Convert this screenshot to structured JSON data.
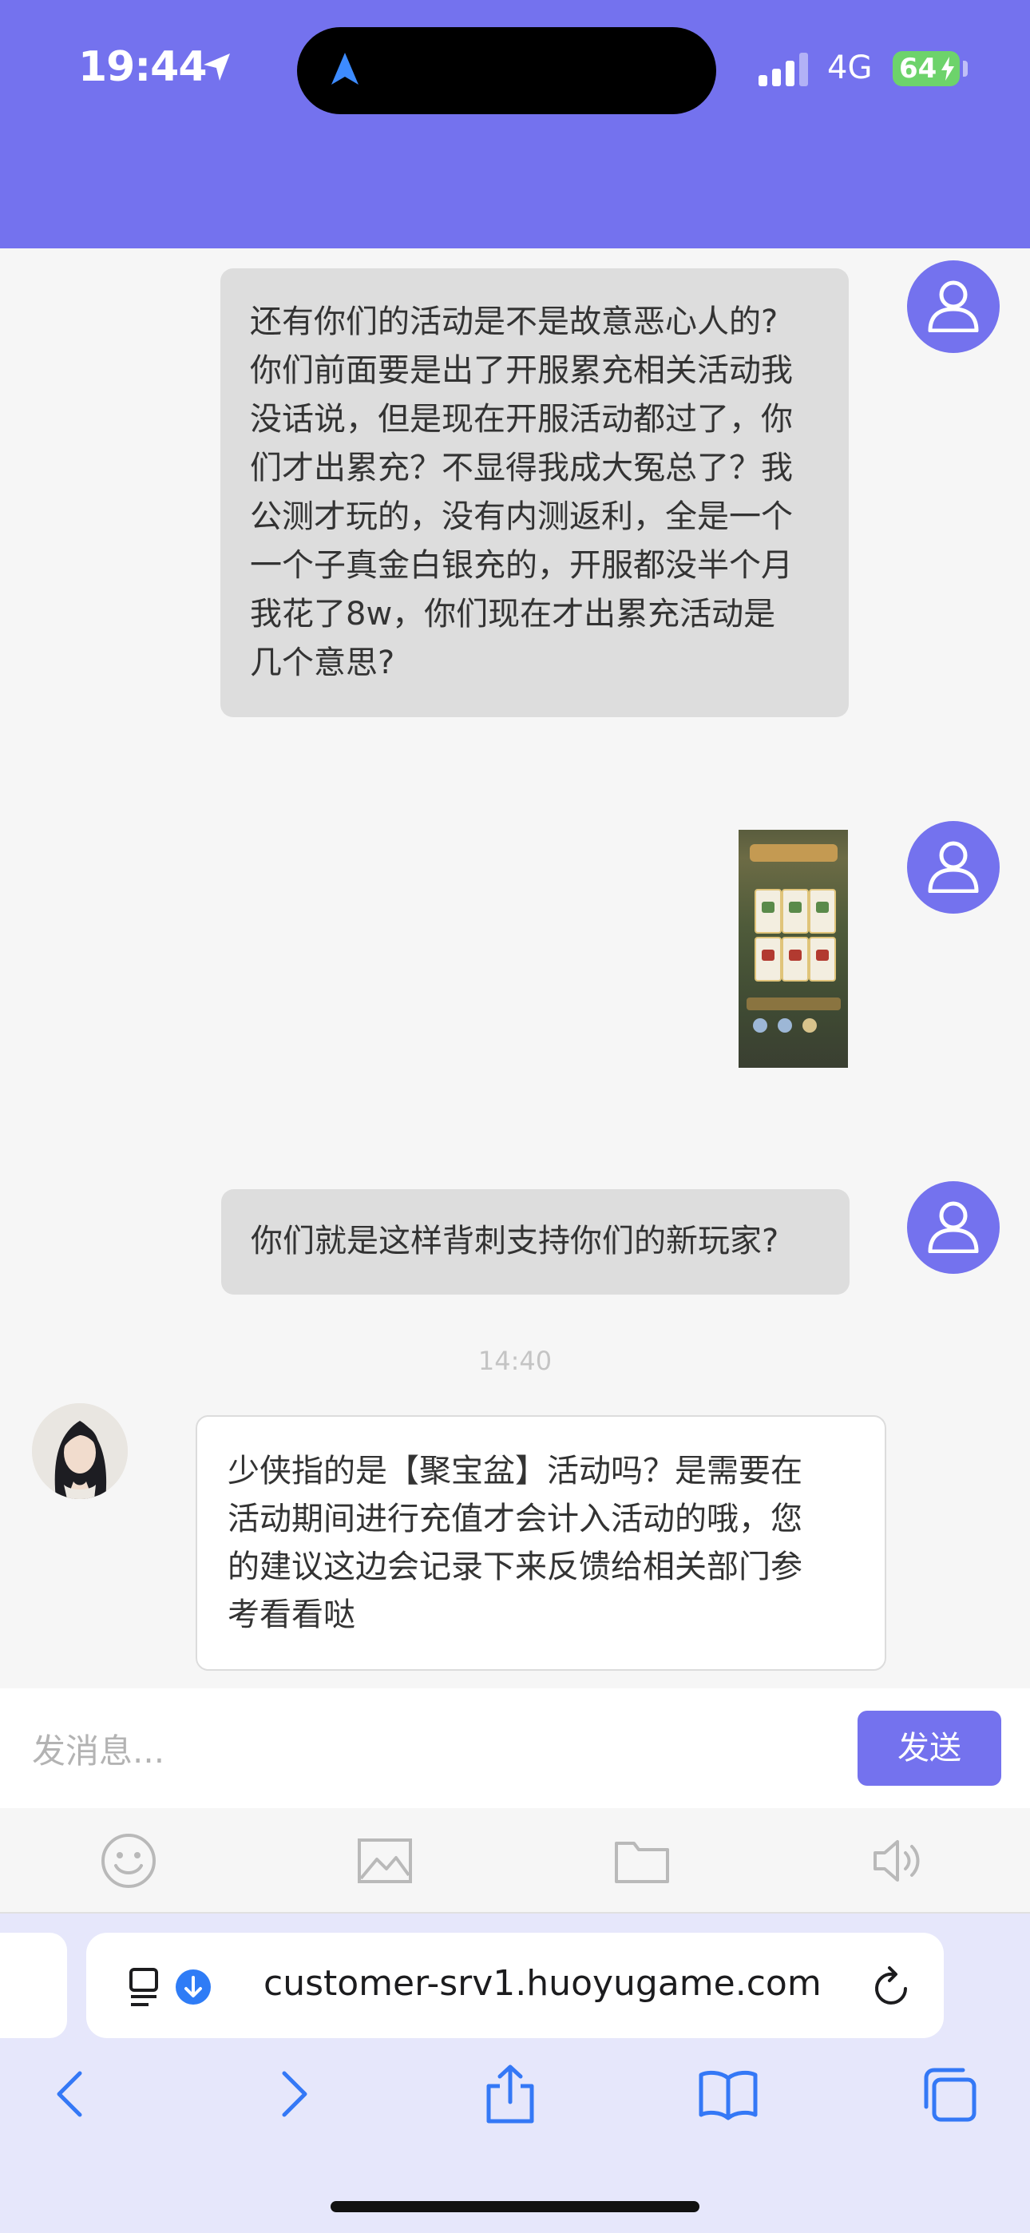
{
  "status_bar": {
    "time": "19:44",
    "network": "4G",
    "battery": "64"
  },
  "messages": [
    {
      "sender": "user",
      "type": "text",
      "lines": [
        "还有你们的活动是不是故意恶心人的?",
        "你们前面要是出了开服累充相关活动我",
        "没话说，但是现在开服活动都过了，你",
        "们才出累充？不显得我成大冤总了？我",
        "公测才玩的，没有内测返利，全是一个",
        "一个子真金白银充的，开服都没半个月",
        "我花了8w，你们现在才出累充活动是",
        "几个意思?"
      ]
    },
    {
      "sender": "user",
      "type": "image"
    },
    {
      "sender": "user",
      "type": "text",
      "text": "你们就是这样背刺支持你们的新玩家?"
    },
    {
      "sender": "agent",
      "type": "text",
      "time": "14:40",
      "lines": [
        "少侠指的是【聚宝盆】活动吗？是需要在",
        "活动期间进行充值才会计入活动的哦，您",
        "的建议这边会记录下来反馈给相关部门参",
        "考看看哒"
      ]
    }
  ],
  "composer": {
    "placeholder": "发消息...",
    "send_label": "发送"
  },
  "toolbar": [
    "emoji-icon",
    "image-icon",
    "folder-icon",
    "speaker-icon"
  ],
  "browser": {
    "url": "customer-srv1.huoyugame.com"
  },
  "colors": {
    "accent": "#7472ee",
    "user_bubble": "#dddddd",
    "agent_bubble": "#ffffff",
    "browser_bar": "#e6e7fb"
  }
}
